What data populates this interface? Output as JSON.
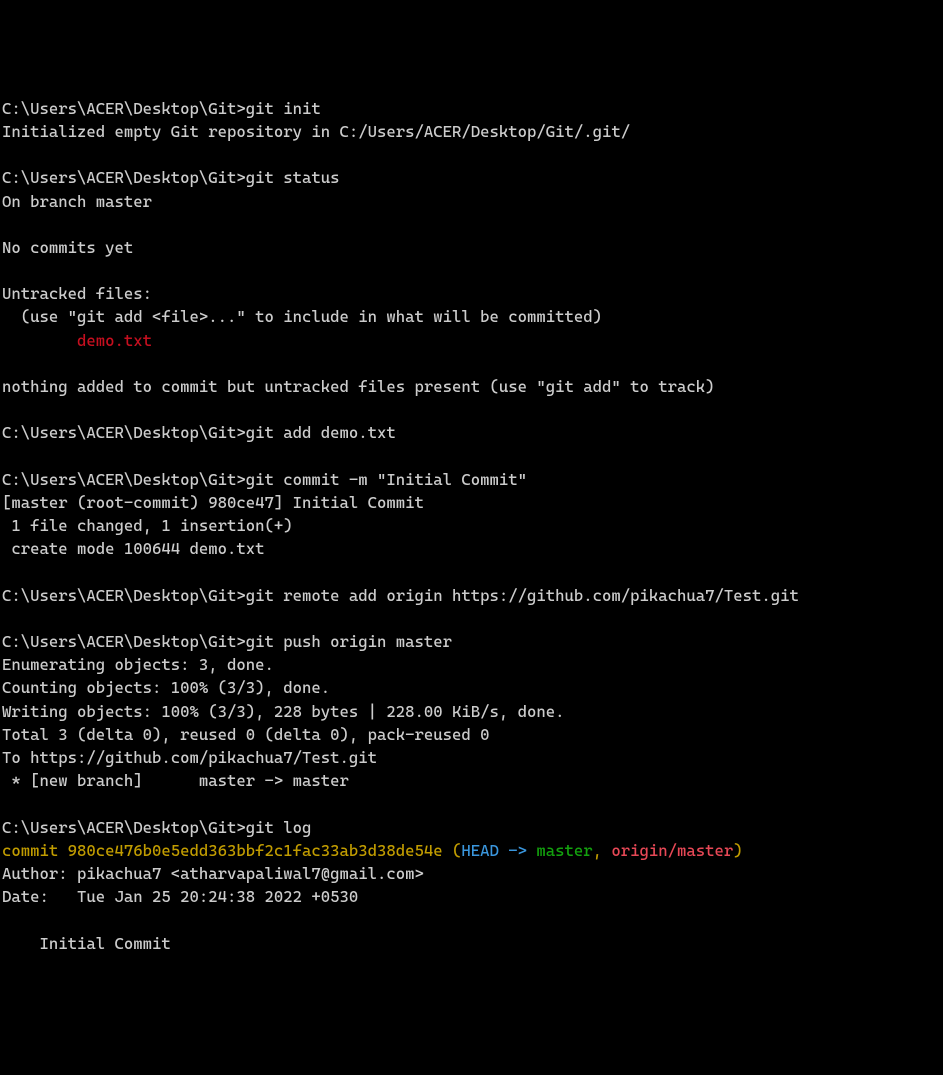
{
  "prompt": "C:\\Users\\ACER\\Desktop\\Git>",
  "block1": {
    "cmd": "git init",
    "out": "Initialized empty Git repository in C:/Users/ACER/Desktop/Git/.git/"
  },
  "block2": {
    "cmd": "git status",
    "out1": "On branch master",
    "out2": "No commits yet",
    "out3": "Untracked files:",
    "out4": "  (use \"git add <file>...\" to include in what will be committed)",
    "untracked_indent": "        ",
    "untracked_file": "demo.txt",
    "out5": "nothing added to commit but untracked files present (use \"git add\" to track)"
  },
  "block3": {
    "cmd": "git add demo.txt"
  },
  "block4": {
    "cmd": "git commit -m \"Initial Commit\"",
    "out1": "[master (root-commit) 980ce47] Initial Commit",
    "out2": " 1 file changed, 1 insertion(+)",
    "out3": " create mode 100644 demo.txt"
  },
  "block5": {
    "cmd": "git remote add origin https://github.com/pikachua7/Test.git"
  },
  "block6": {
    "cmd": "git push origin master",
    "out1": "Enumerating objects: 3, done.",
    "out2": "Counting objects: 100% (3/3), done.",
    "out3": "Writing objects: 100% (3/3), 228 bytes | 228.00 KiB/s, done.",
    "out4": "Total 3 (delta 0), reused 0 (delta 0), pack-reused 0",
    "out5": "To https://github.com/pikachua7/Test.git",
    "out6": " * [new branch]      master -> master"
  },
  "block7": {
    "cmd": "git log",
    "commit_word": "commit ",
    "commit_hash": "980ce476b0e5edd363bbf2c1fac33ab3d38de54e",
    "ref_open": " (",
    "ref_head": "HEAD -> ",
    "ref_master": "master",
    "ref_comma": ", ",
    "ref_origin": "origin/master",
    "ref_close": ")",
    "author": "Author: pikachua7 <atharvapaliwal7@gmail.com>",
    "date": "Date:   Tue Jan 25 20:24:38 2022 +0530",
    "msg": "    Initial Commit"
  }
}
